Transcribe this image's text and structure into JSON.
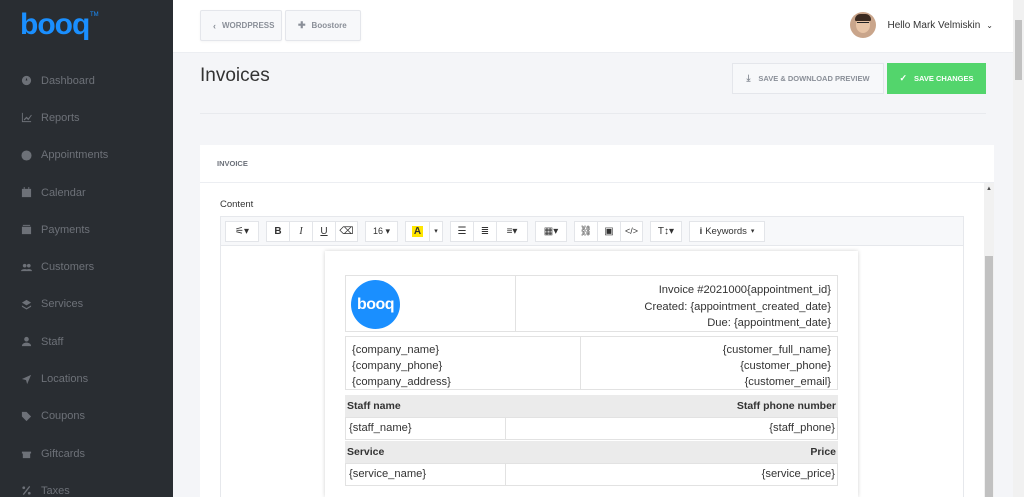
{
  "app": {
    "logo_text": "booq",
    "logo_tm": "TM"
  },
  "sidebar": {
    "items": [
      {
        "label": "Dashboard",
        "icon": "dashboard-icon"
      },
      {
        "label": "Reports",
        "icon": "chart-icon"
      },
      {
        "label": "Appointments",
        "icon": "clock-icon"
      },
      {
        "label": "Calendar",
        "icon": "calendar-icon"
      },
      {
        "label": "Payments",
        "icon": "wallet-icon"
      },
      {
        "label": "Customers",
        "icon": "users-icon"
      },
      {
        "label": "Services",
        "icon": "layers-icon"
      },
      {
        "label": "Staff",
        "icon": "user-icon"
      },
      {
        "label": "Locations",
        "icon": "location-arrow-icon"
      },
      {
        "label": "Coupons",
        "icon": "tag-icon"
      },
      {
        "label": "Giftcards",
        "icon": "gift-icon"
      },
      {
        "label": "Taxes",
        "icon": "percent-icon"
      }
    ]
  },
  "topbar": {
    "crumb_wordpress": "WORDPRESS",
    "crumb_boostore": "Boostore",
    "user_greeting": "Hello Mark Velmiskin"
  },
  "main": {
    "title": "Invoices",
    "preview_button": "SAVE & DOWNLOAD PREVIEW",
    "save_button": "SAVE CHANGES",
    "card_title": "INVOICE",
    "content_label": "Content"
  },
  "toolbar": {
    "font_size": "16",
    "keywords_label": "Keywords"
  },
  "invoice": {
    "logo_text": "booq",
    "number": "Invoice #2021000{appointment_id}",
    "created": "Created: {appointment_created_date}",
    "due": "Due: {appointment_date}",
    "company_name": "{company_name}",
    "company_phone": "{company_phone}",
    "company_address": "{company_address}",
    "customer_full_name": "{customer_full_name}",
    "customer_phone": "{customer_phone}",
    "customer_email": "{customer_email}",
    "staff_name_header": "Staff name",
    "staff_phone_header": "Staff phone number",
    "staff_name": "{staff_name}",
    "staff_phone": "{staff_phone}",
    "service_header": "Service",
    "price_header": "Price",
    "service_name": "{service_name}",
    "service_price": "{service_price}"
  },
  "colors": {
    "sidebar_bg": "#292d32",
    "brand": "#1a8fff",
    "save_green": "#53d56c"
  }
}
